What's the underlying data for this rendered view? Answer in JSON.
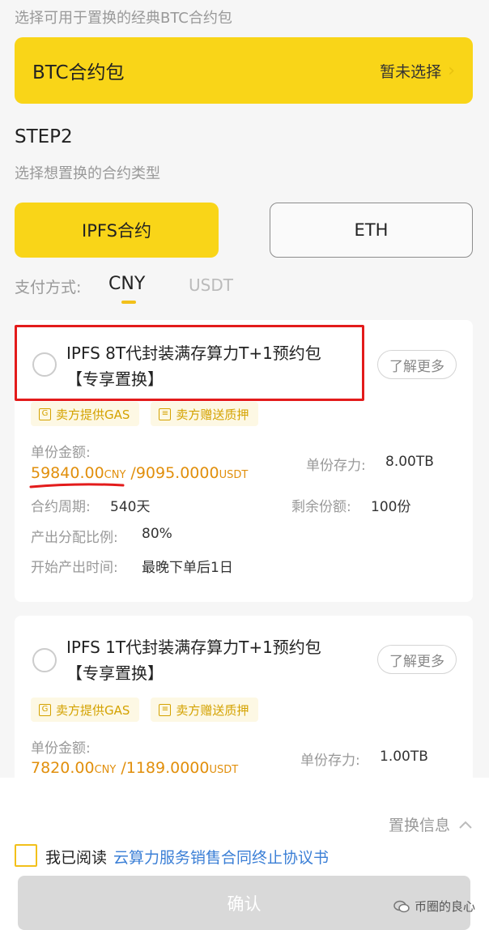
{
  "step1": {
    "subtitle": "选择可用于置换的经典BTC合约包",
    "package_label": "BTC合约包",
    "package_value": "暂未选择",
    "chevron_icon": "chevron-right-icon"
  },
  "step2": {
    "title": "STEP2",
    "subtitle": "选择想置换的合约类型",
    "types": [
      "IPFS合约",
      "ETH"
    ]
  },
  "payment": {
    "label": "支付方式:",
    "options": [
      "CNY",
      "USDT"
    ],
    "selected": "CNY"
  },
  "products": [
    {
      "title_line1": "IPFS 8T代封装满存算力T+1预约包",
      "title_line2": "【专享置换】",
      "more_label": "了解更多",
      "tags": [
        "卖方提供GAS",
        "卖方赠送质押"
      ],
      "unit_price_label": "单份金额:",
      "price_cny": "59840.00",
      "price_cny_unit": "CNY",
      "price_usdt": "/9095.0000",
      "price_usdt_unit": "USDT",
      "storage_label": "单份存力:",
      "storage_value": "8.00TB",
      "period_label": "合约周期:",
      "period_value": "540天",
      "remaining_label": "剩余份额:",
      "remaining_value": "100份",
      "ratio_label": "产出分配比例:",
      "ratio_value": "80%",
      "start_label": "开始产出时间:",
      "start_value": "最晚下单后1日"
    },
    {
      "title_line1": "IPFS 1T代封装满存算力T+1预约包",
      "title_line2": "【专享置换】",
      "more_label": "了解更多",
      "tags": [
        "卖方提供GAS",
        "卖方赠送质押"
      ],
      "unit_price_label": "单份金额:",
      "price_cny": "7820.00",
      "price_cny_unit": "CNY",
      "price_usdt": "/1189.0000",
      "price_usdt_unit": "USDT",
      "storage_label": "单份存力:",
      "storage_value": "1.00TB"
    }
  ],
  "footer": {
    "swap_info_label": "置换信息",
    "agree_prefix": "我已阅读",
    "agree_link": "云算力服务销售合同终止协议书",
    "confirm_label": "确认",
    "watermark": "币圈的良心"
  },
  "colors": {
    "accent": "#f9d518",
    "price": "#e18f0c",
    "link": "#3b7fd6",
    "highlight_red": "#e31b1b",
    "tag_text": "#d4a200"
  }
}
